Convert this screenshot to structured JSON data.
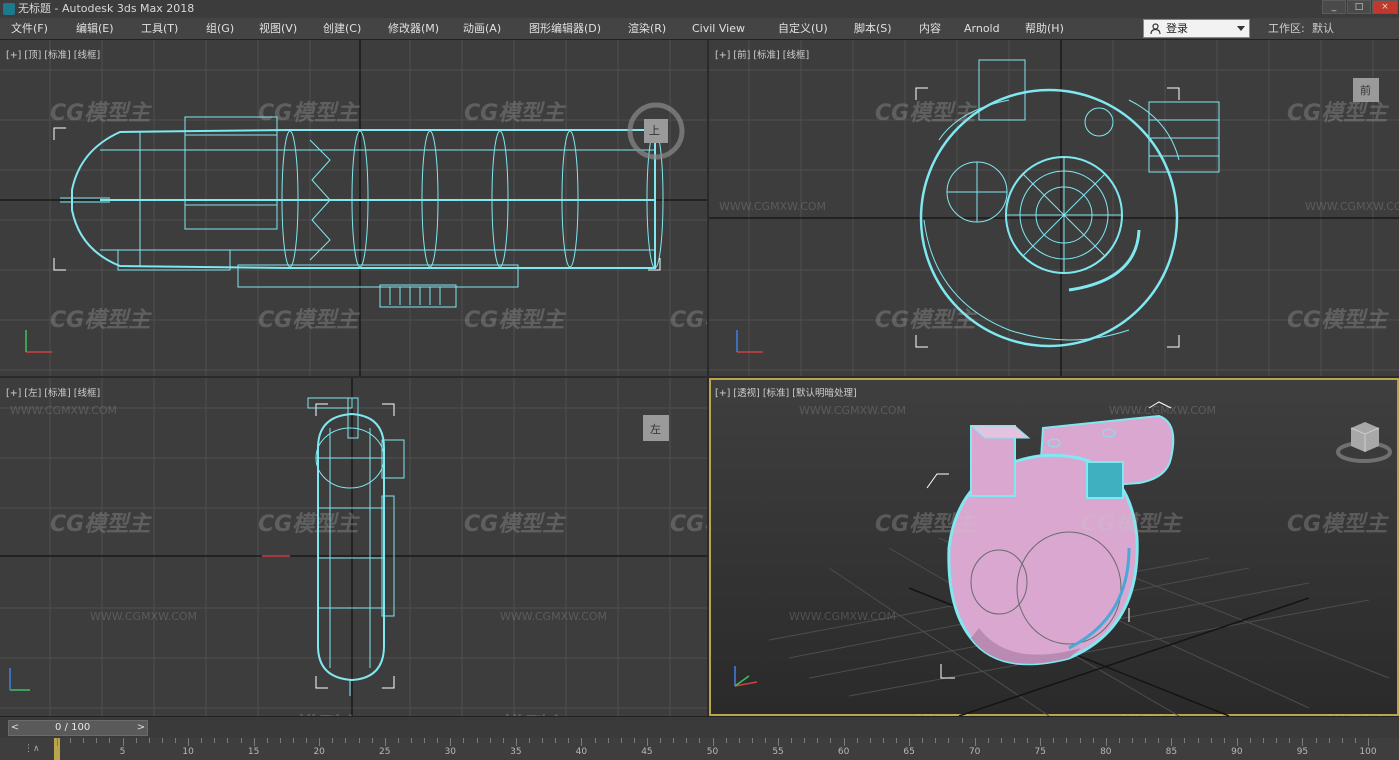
{
  "window": {
    "title": "无标题 - Autodesk 3ds Max 2018",
    "controls": [
      "_",
      "□",
      "×"
    ]
  },
  "menu": {
    "items": [
      "文件(F)",
      "编辑(E)",
      "工具(T)",
      "组(G)",
      "视图(V)",
      "创建(C)",
      "修改器(M)",
      "动画(A)",
      "图形编辑器(D)",
      "渲染(R)",
      "Civil View",
      "自定义(U)",
      "脚本(S)",
      "内容",
      "Arnold",
      "帮助(H)"
    ],
    "login": "登录",
    "workspace_label": "工作区:",
    "workspace_value": "默认"
  },
  "viewports": {
    "top": {
      "label": "[+] [顶] [标准] [线框]",
      "cube_label": "上"
    },
    "front": {
      "label": "[+] [前] [标准] [线框]",
      "cube_label": "前"
    },
    "left": {
      "label": "[+] [左] [标准] [线框]",
      "cube_label": "左"
    },
    "perspective": {
      "label": "[+] [透视] [标准] [默认明暗处理]"
    }
  },
  "watermark": {
    "logo": "CG模型主",
    "url": "WWW.CGMXW.COM"
  },
  "timeline": {
    "frame_display": "0 / 100",
    "prev": "<",
    "next": ">",
    "ruler_labels": [
      "0",
      "5",
      "10",
      "15",
      "20",
      "25",
      "30",
      "35",
      "40",
      "45",
      "50",
      "55",
      "60",
      "65",
      "70",
      "75",
      "80",
      "85",
      "90",
      "95",
      "100"
    ]
  },
  "colors": {
    "viewport_bg": "#3d3d3d",
    "grid": "#555555",
    "wire": "#7fe8f0",
    "active_border": "#b9a64a",
    "object_pink": "#d9a7d0"
  }
}
